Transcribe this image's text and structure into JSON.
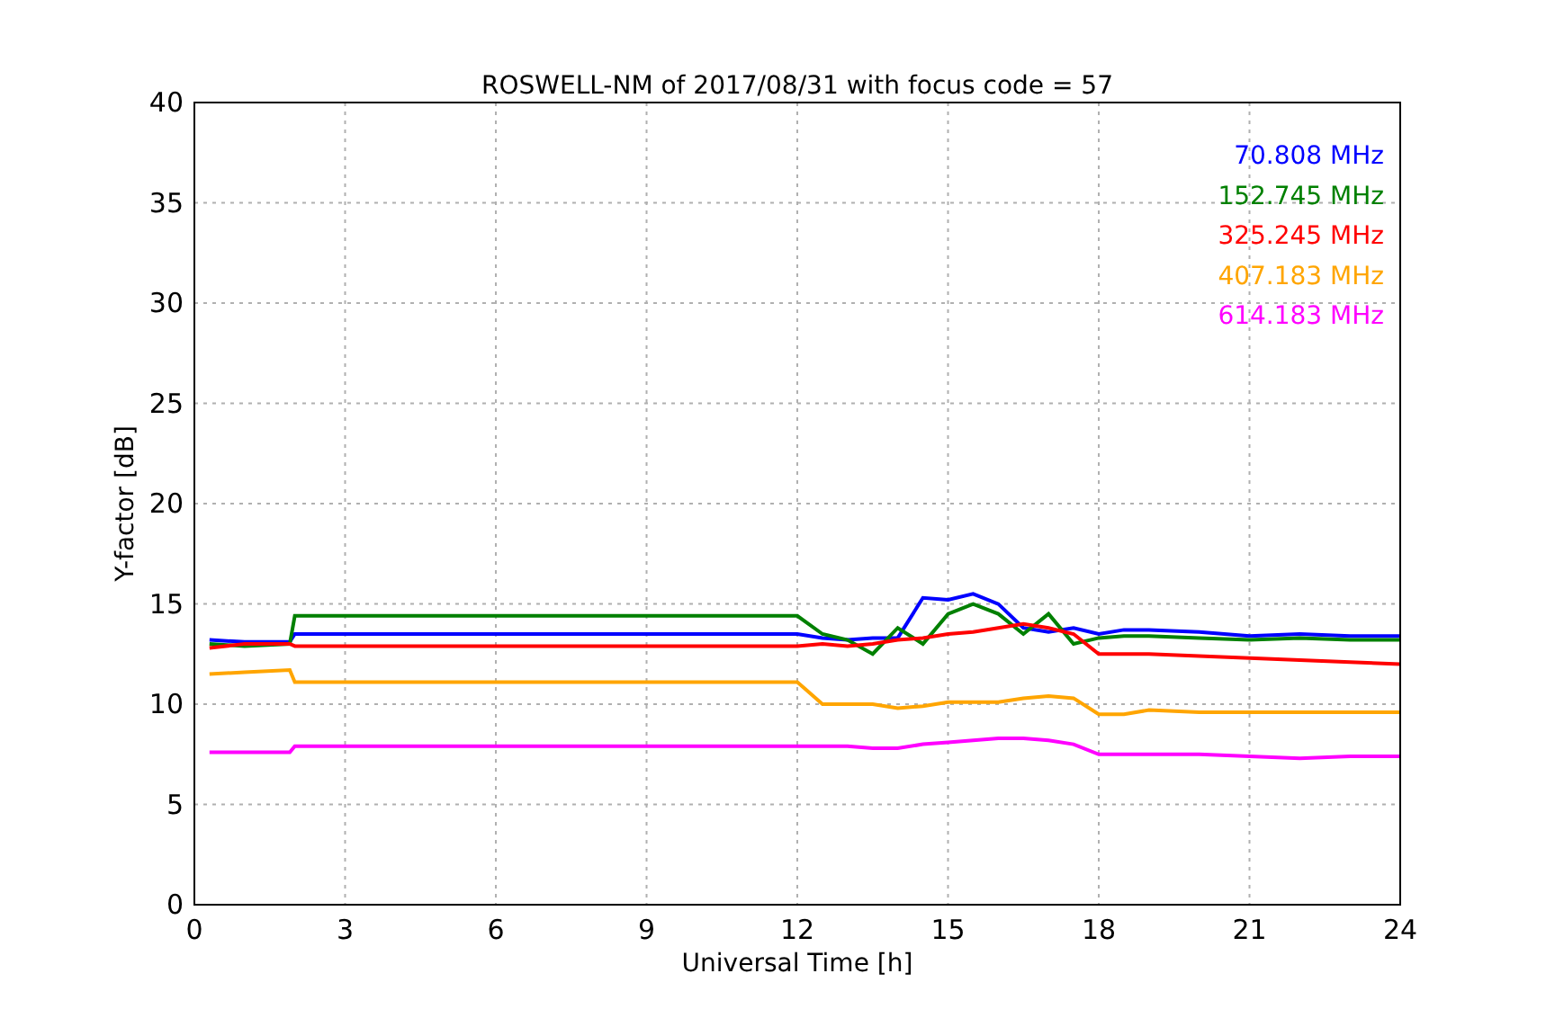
{
  "chart_data": {
    "type": "line",
    "title": "ROSWELL-NM of 2017/08/31 with focus code = 57",
    "xlabel": "Universal Time [h]",
    "ylabel": "Y-factor [dB]",
    "x": [
      0.3,
      1.0,
      1.9,
      2.0,
      12.0,
      12.5,
      13,
      13.5,
      14,
      14.5,
      15,
      15.5,
      16,
      16.5,
      17,
      17.5,
      18,
      18.5,
      19,
      20,
      21,
      22,
      23,
      24
    ],
    "series": [
      {
        "name": "70.808 MHz",
        "color": "#0000ff",
        "values": [
          13.2,
          13.1,
          13.1,
          13.5,
          13.5,
          13.3,
          13.2,
          13.3,
          13.3,
          15.3,
          15.2,
          15.5,
          15.0,
          13.8,
          13.6,
          13.8,
          13.5,
          13.7,
          13.7,
          13.6,
          13.4,
          13.5,
          13.4,
          13.4
        ]
      },
      {
        "name": "152.745 MHz",
        "color": "#008000",
        "values": [
          13.0,
          12.9,
          13.0,
          14.4,
          14.4,
          13.5,
          13.2,
          12.5,
          13.8,
          13.0,
          14.5,
          15.0,
          14.5,
          13.5,
          14.5,
          13.0,
          13.3,
          13.4,
          13.4,
          13.3,
          13.2,
          13.3,
          13.2,
          13.2
        ]
      },
      {
        "name": "325.245 MHz",
        "color": "#ff0000",
        "values": [
          12.8,
          13.0,
          13.0,
          12.9,
          12.9,
          13.0,
          12.9,
          13.0,
          13.2,
          13.3,
          13.5,
          13.6,
          13.8,
          14.0,
          13.8,
          13.5,
          12.5,
          12.5,
          12.5,
          12.4,
          12.3,
          12.2,
          12.1,
          12.0
        ]
      },
      {
        "name": "407.183 MHz",
        "color": "#ffa500",
        "values": [
          11.5,
          11.6,
          11.7,
          11.1,
          11.1,
          10.0,
          10.0,
          10.0,
          9.8,
          9.9,
          10.1,
          10.1,
          10.1,
          10.3,
          10.4,
          10.3,
          9.5,
          9.5,
          9.7,
          9.6,
          9.6,
          9.6,
          9.6,
          9.6
        ]
      },
      {
        "name": "614.183 MHz",
        "color": "#ff00ff",
        "values": [
          7.6,
          7.6,
          7.6,
          7.9,
          7.9,
          7.9,
          7.9,
          7.8,
          7.8,
          8.0,
          8.1,
          8.2,
          8.3,
          8.3,
          8.2,
          8.0,
          7.5,
          7.5,
          7.5,
          7.5,
          7.4,
          7.3,
          7.4,
          7.4
        ]
      }
    ],
    "grid": true,
    "xlim": [
      0,
      24
    ],
    "ylim": [
      0,
      40
    ],
    "xticks": [
      0,
      3,
      6,
      9,
      12,
      15,
      18,
      21,
      24
    ],
    "yticks": [
      0,
      5,
      10,
      15,
      20,
      25,
      30,
      35,
      40
    ]
  }
}
